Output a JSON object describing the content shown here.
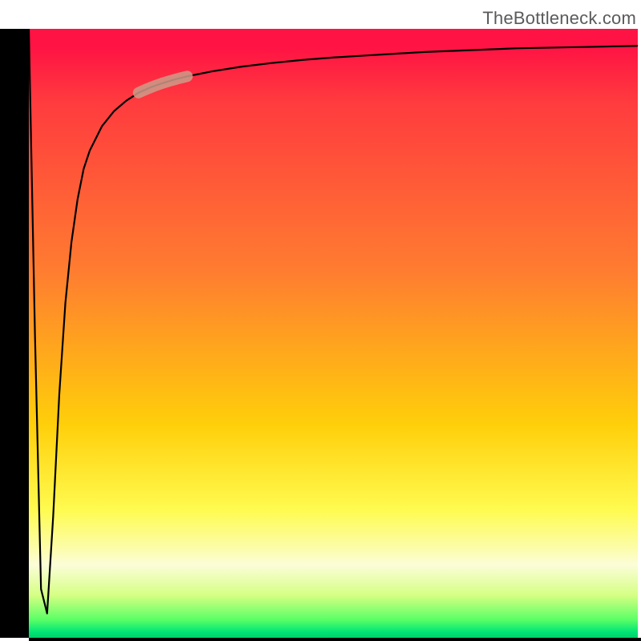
{
  "attribution": "TheBottleneck.com",
  "colors": {
    "gradient_top": "#ff1344",
    "gradient_mid1": "#ff7d30",
    "gradient_mid2": "#ffcf0a",
    "gradient_bottom": "#00e676",
    "curve": "#000000",
    "marker": "#cc9c8a",
    "axes": "#000000"
  },
  "chart_data": {
    "type": "line",
    "title": "",
    "xlabel": "",
    "ylabel": "",
    "xlim": [
      0,
      100
    ],
    "ylim": [
      0,
      100
    ],
    "grid": false,
    "legend": false,
    "series": [
      {
        "name": "bottleneck-curve",
        "x": [
          0,
          1,
          2,
          3,
          4,
          5,
          6,
          7,
          8,
          9,
          10,
          12,
          14,
          16,
          18,
          20,
          22,
          24,
          26,
          28,
          30,
          35,
          40,
          45,
          50,
          55,
          60,
          65,
          70,
          75,
          80,
          85,
          90,
          95,
          100
        ],
        "values": [
          100,
          50,
          8,
          4,
          20,
          40,
          55,
          65,
          72,
          77,
          80,
          84,
          86.5,
          88.2,
          89.5,
          90.4,
          91.1,
          91.7,
          92.2,
          92.6,
          93.0,
          93.8,
          94.4,
          94.9,
          95.3,
          95.6,
          95.9,
          96.2,
          96.4,
          96.6,
          96.8,
          96.9,
          97.0,
          97.1,
          97.2
        ]
      }
    ],
    "marker": {
      "series": "bottleneck-curve",
      "x_range": [
        18,
        26
      ],
      "note": "highlighted segment on curve"
    }
  }
}
